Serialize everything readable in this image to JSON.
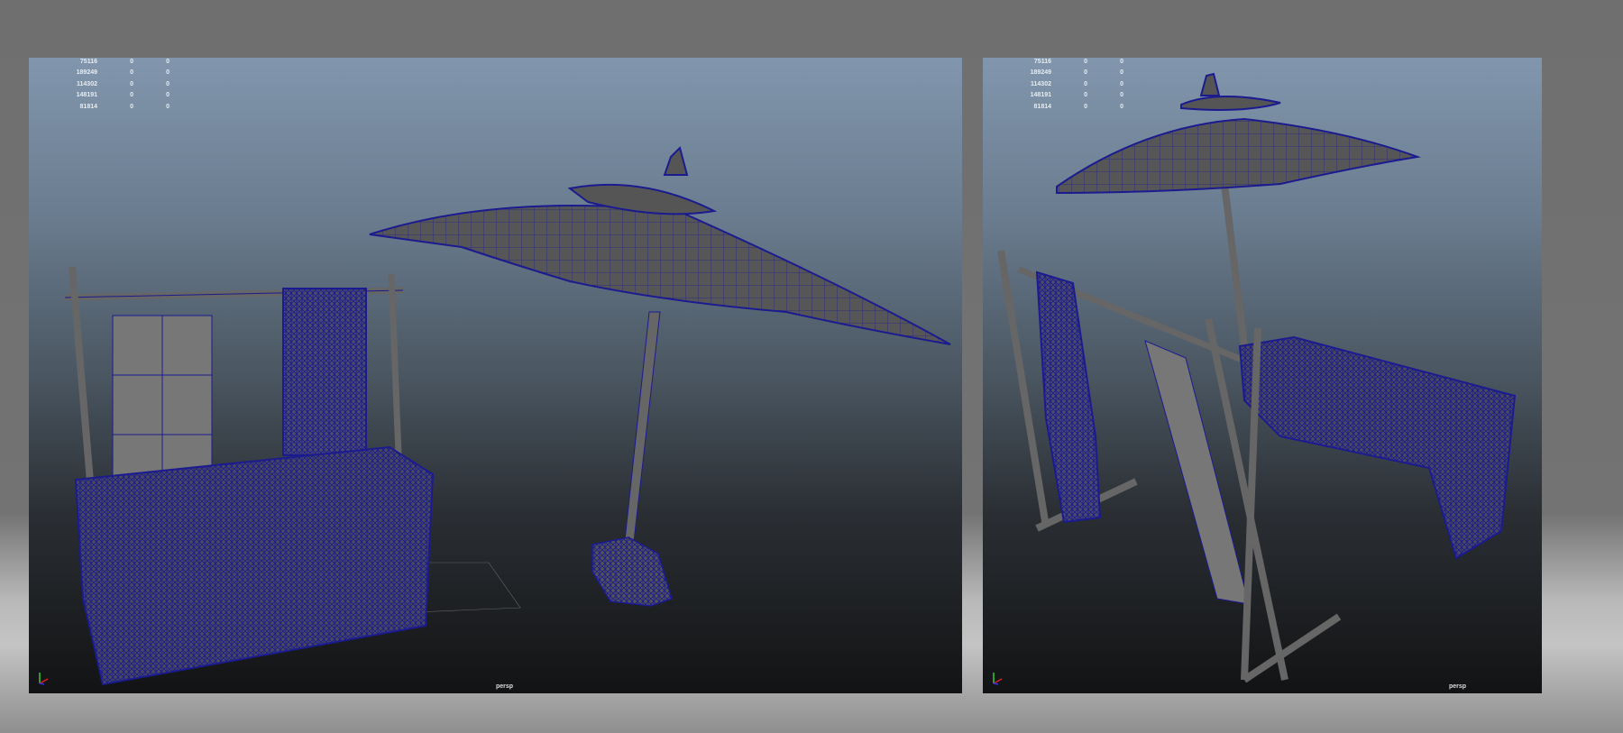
{
  "viewports": [
    {
      "camera": "persp",
      "stats": [
        [
          "75116",
          "0",
          "0"
        ],
        [
          "189249",
          "0",
          "0"
        ],
        [
          "114302",
          "0",
          "0"
        ],
        [
          "148191",
          "0",
          "0"
        ],
        [
          "81814",
          "0",
          "0"
        ]
      ]
    },
    {
      "camera": "persp",
      "stats": [
        [
          "75116",
          "0",
          "0"
        ],
        [
          "189249",
          "0",
          "0"
        ],
        [
          "114302",
          "0",
          "0"
        ],
        [
          "148191",
          "0",
          "0"
        ],
        [
          "81814",
          "0",
          "0"
        ]
      ]
    }
  ],
  "colors": {
    "wire": "#1b1b8f",
    "mesh": "#5a5a5a"
  }
}
